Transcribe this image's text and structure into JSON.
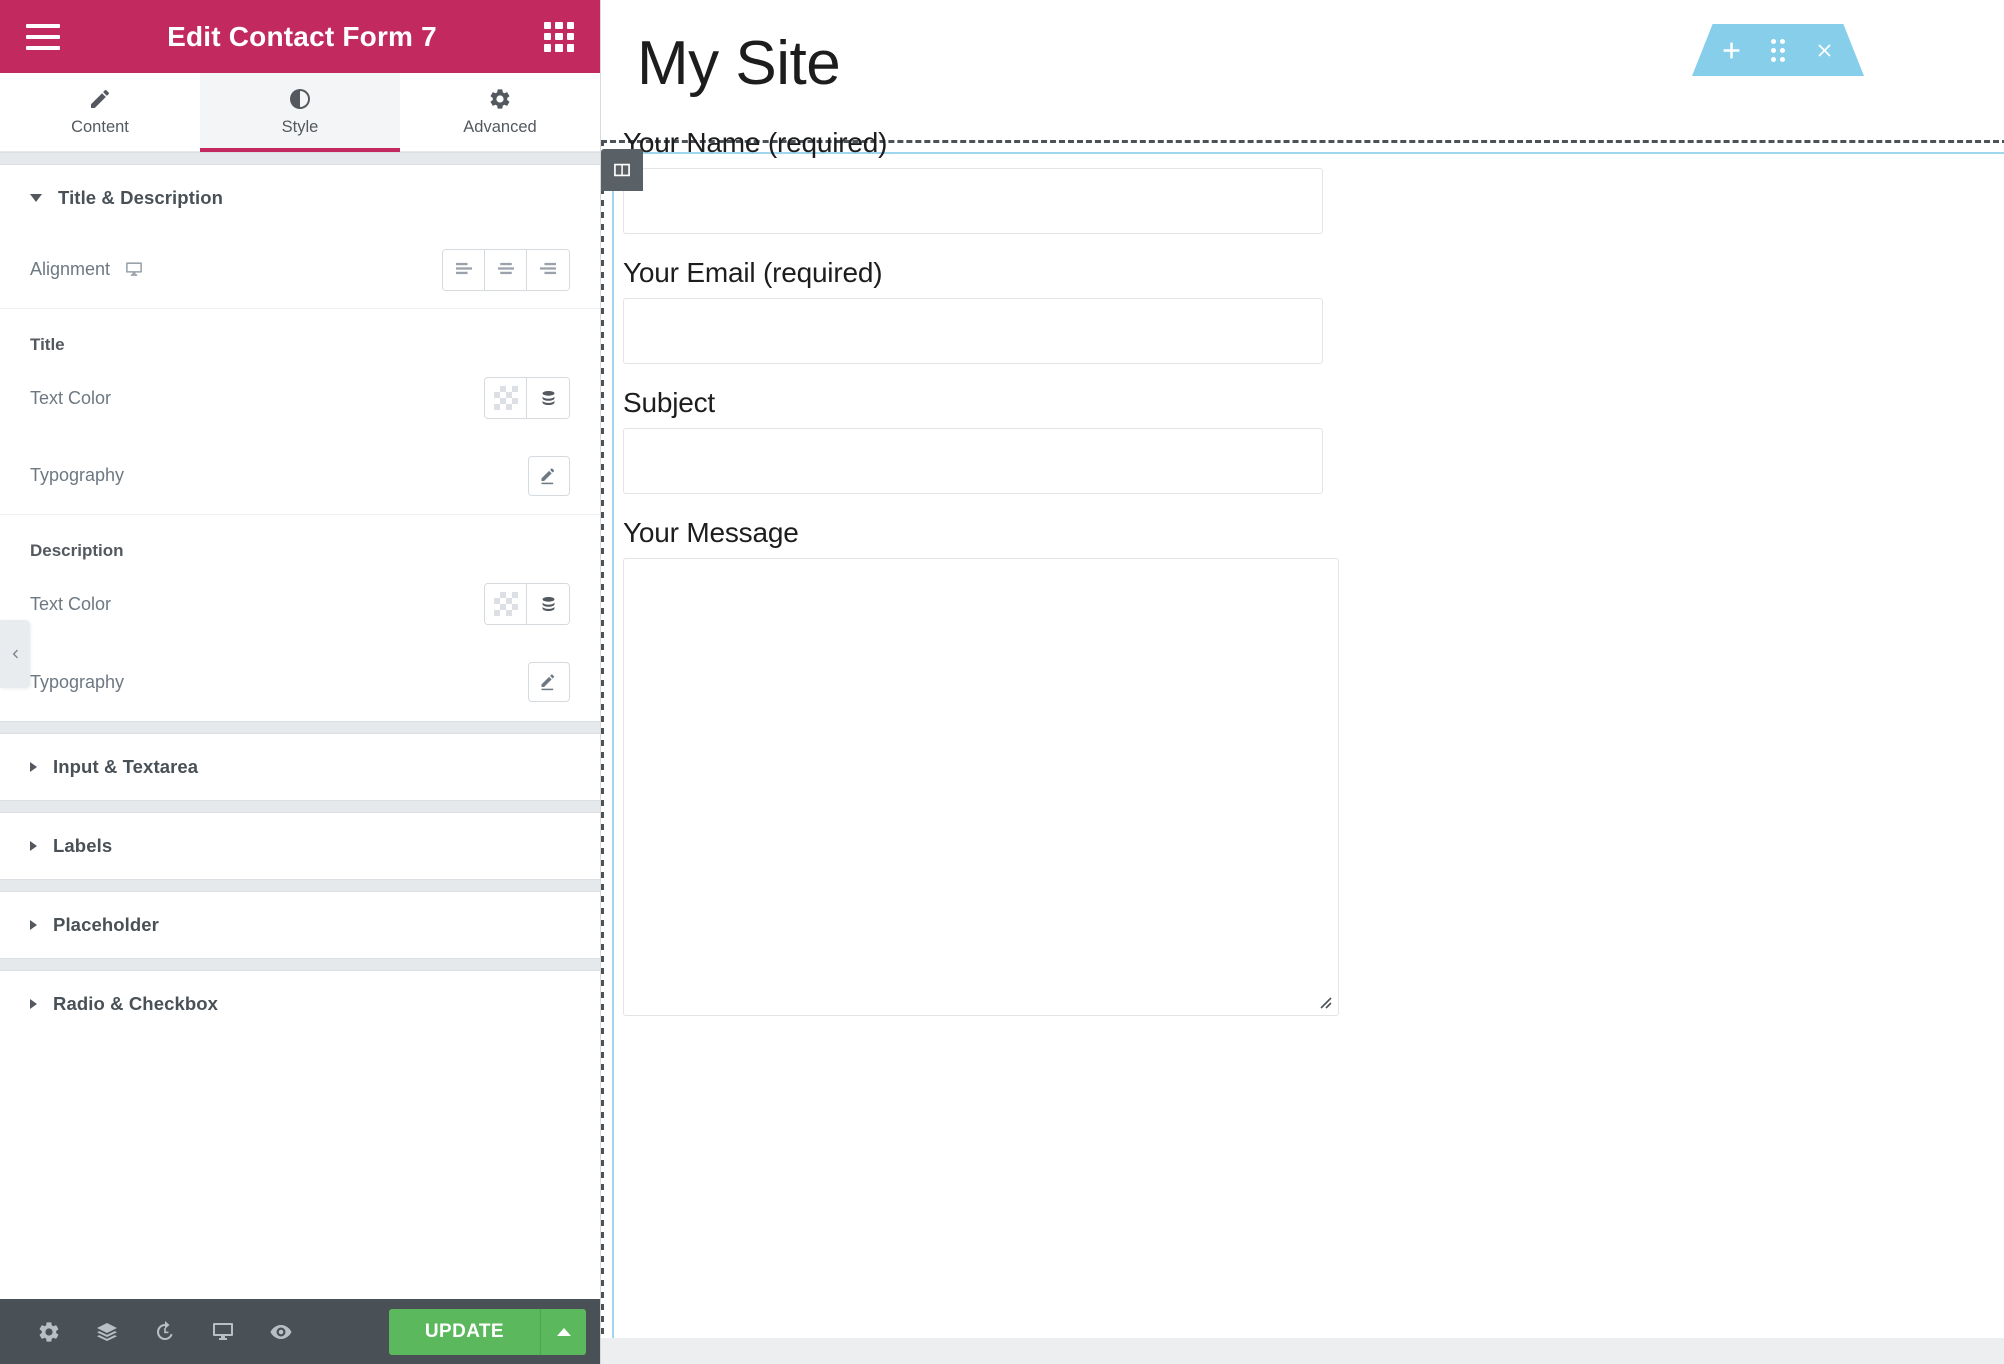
{
  "panel": {
    "header": {
      "title": "Edit Contact Form 7",
      "menu_icon": "hamburger-menu-icon",
      "widgets_icon": "widgets-grid-icon"
    },
    "tabs": [
      {
        "label": "Content",
        "icon": "pencil-icon",
        "active": false
      },
      {
        "label": "Style",
        "icon": "contrast-icon",
        "active": true
      },
      {
        "label": "Advanced",
        "icon": "gear-icon",
        "active": false
      }
    ],
    "sections": {
      "title_description": {
        "label": "Title & Description",
        "expanded": true,
        "alignment": {
          "label": "Alignment",
          "device_icon": "monitor-icon",
          "options": [
            "align-left",
            "align-center",
            "align-right"
          ],
          "selected": ""
        },
        "title_group": {
          "label": "Title",
          "text_color_label": "Text Color",
          "typography_label": "Typography",
          "color_value": "",
          "swatch_icon": "transparent-checker-icon",
          "global_icon": "global-colors-icon",
          "typography_icon": "pencil-edit-icon"
        },
        "description_group": {
          "label": "Description",
          "text_color_label": "Text Color",
          "typography_label": "Typography",
          "color_value": "",
          "swatch_icon": "transparent-checker-icon",
          "global_icon": "global-colors-icon",
          "typography_icon": "pencil-edit-icon"
        }
      },
      "collapsed": [
        {
          "label": "Input & Textarea"
        },
        {
          "label": "Labels"
        },
        {
          "label": "Placeholder"
        },
        {
          "label": "Radio & Checkbox"
        }
      ]
    },
    "footer": {
      "icons": [
        {
          "name": "settings-gear-icon"
        },
        {
          "name": "navigator-layers-icon"
        },
        {
          "name": "history-clock-icon"
        },
        {
          "name": "responsive-monitor-icon"
        },
        {
          "name": "preview-eye-icon"
        }
      ],
      "update_label": "UPDATE",
      "update_caret_icon": "caret-up-icon",
      "update_color": "#5cb85c"
    }
  },
  "canvas": {
    "site_title": "My Site",
    "collapse_tab_icon": "chevron-left-icon",
    "column_handle_icon": "two-column-layout-icon",
    "section_toolbar": {
      "color": "#87CEEB",
      "buttons": [
        {
          "name": "add-section-icon",
          "icon": "plus"
        },
        {
          "name": "drag-handle-icon",
          "icon": "dots6"
        },
        {
          "name": "delete-section-icon",
          "icon": "close"
        }
      ]
    },
    "form": {
      "fields": [
        {
          "label": "Your Name (required)",
          "type": "text",
          "value": "",
          "placeholder": ""
        },
        {
          "label": "Your Email (required)",
          "type": "email",
          "value": "",
          "placeholder": ""
        },
        {
          "label": "Subject",
          "type": "text",
          "value": "",
          "placeholder": ""
        },
        {
          "label": "Your Message",
          "type": "textarea",
          "value": "",
          "placeholder": ""
        }
      ]
    }
  },
  "colors": {
    "header_pink": "#C2295F",
    "footer_dark": "#495157",
    "accent_blue": "#87CEEB",
    "update_green": "#5cb85c"
  }
}
